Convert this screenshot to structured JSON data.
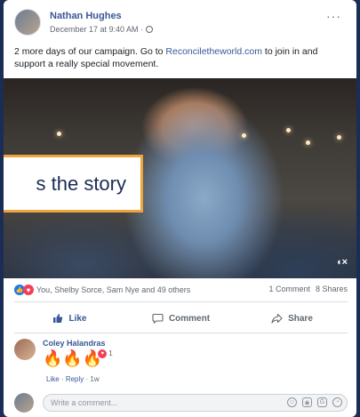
{
  "post": {
    "author": "Nathan Hughes",
    "timestamp": "December 17 at 9:40 AM ·",
    "more_label": "···",
    "text_before": "2 more days of our campaign. Go to ",
    "link_text": "Reconciletheworld.com",
    "text_after": " to join in and support a really special movement."
  },
  "video": {
    "overlay_caption": "s the story",
    "volume_label": "◖×"
  },
  "stats": {
    "reactions_text": "You, Shelby Sorce, Sam Nye and 49 others",
    "comments": "1 Comment",
    "shares": "8 Shares"
  },
  "actions": {
    "like": "Like",
    "comment": "Comment",
    "share": "Share"
  },
  "comment": {
    "author": "Coley Halandras",
    "emoji": "🔥🔥🔥",
    "reaction_count": "1",
    "like_label": "Like",
    "reply_label": "Reply",
    "time": "1w"
  },
  "composer": {
    "placeholder": "Write a comment..."
  },
  "colors": {
    "page_background": "#1b2d54",
    "link_blue": "#385898",
    "overlay_border": "#f0a43c",
    "like_blue": "#1877f2",
    "love_red": "#f33e58"
  },
  "icons": [
    "globe-icon",
    "like-reaction-icon",
    "love-reaction-icon",
    "thumbs-up-icon",
    "comment-bubble-icon",
    "share-arrow-icon",
    "emoji-icon",
    "camera-icon",
    "gif-icon",
    "sticker-icon",
    "volume-icon"
  ]
}
